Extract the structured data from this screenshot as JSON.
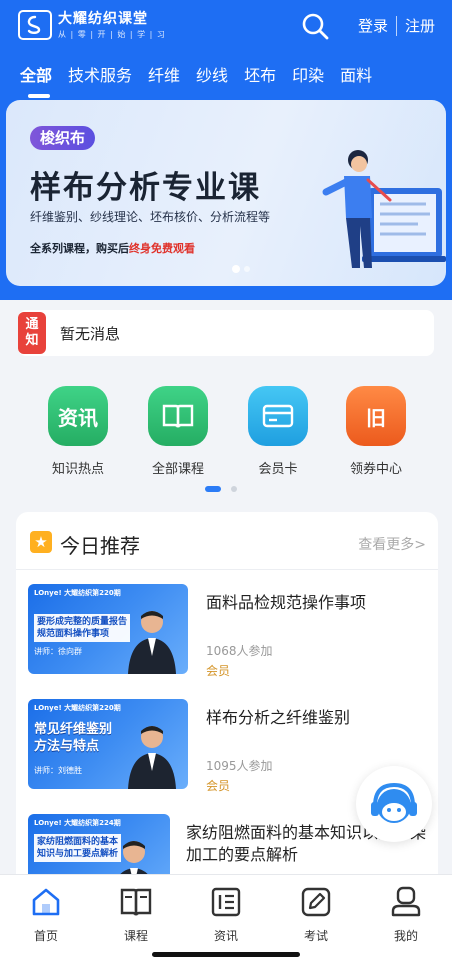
{
  "brand": {
    "title": "大耀纺织课堂",
    "subtitle": "从 | 零 | 开 | 始 | 学 | 习"
  },
  "header": {
    "login": "登录",
    "register": "注册"
  },
  "tabs": [
    {
      "label": "全部",
      "active": true
    },
    {
      "label": "技术服务"
    },
    {
      "label": "纤维"
    },
    {
      "label": "纱线"
    },
    {
      "label": "坯布"
    },
    {
      "label": "印染"
    },
    {
      "label": "面料"
    }
  ],
  "banner": {
    "badge": "梭织布",
    "title": "样布分析专业课",
    "desc": "纤维鉴别、纱线理论、坯布核价、分析流程等",
    "note_prefix": "全系列课程，购买后",
    "note_highlight": "终身免费观看"
  },
  "notice": {
    "tag_line1": "通",
    "tag_line2": "知",
    "text": "暂无消息"
  },
  "quick_menu": [
    {
      "icon_text": "资讯",
      "label": "知识热点",
      "icon": "news-icon",
      "color": "#2fbf71"
    },
    {
      "icon_text": "",
      "label": "全部课程",
      "icon": "book-icon",
      "color": "#2ec36f"
    },
    {
      "icon_text": "",
      "label": "会员卡",
      "icon": "card-icon",
      "color": "#2ab4ea"
    },
    {
      "icon_text": "旧",
      "label": "领券中心",
      "icon": "coupon-icon",
      "color": "#f26b2a"
    }
  ],
  "recommend": {
    "title": "今日推荐",
    "more": "查看更多>",
    "courses": [
      {
        "title": "面料品检规范操作事项",
        "count": "1068人参加",
        "tag": "会员",
        "thumb_top": "LOnye! 大耀纺织第220期",
        "thumb_cap": "要形成完整的质量报告\n规范面料操作事项",
        "thumb_teacher": "讲师：徐向群"
      },
      {
        "title": "样布分析之纤维鉴别",
        "count": "1095人参加",
        "tag": "会员",
        "thumb_top": "LOnye! 大耀纺织第220期",
        "thumb_cap": "常见纤维鉴别\n方法与特点",
        "thumb_teacher": "讲师：刘德胜"
      },
      {
        "title": "家纺阻燃面料的基本知识以及印染加工的要点解析",
        "count": "",
        "tag": "",
        "thumb_top": "LOnye! 大耀纺织第224期",
        "thumb_cap": "家纺阻燃面料的基本\n知识与加工要点解析",
        "thumb_teacher": ""
      }
    ]
  },
  "tabbar": [
    {
      "label": "首页",
      "icon": "home-icon",
      "active": true
    },
    {
      "label": "课程",
      "icon": "course-book-icon"
    },
    {
      "label": "资讯",
      "icon": "info-icon"
    },
    {
      "label": "考试",
      "icon": "exam-icon"
    },
    {
      "label": "我的",
      "icon": "profile-icon"
    }
  ],
  "colors": {
    "primary": "#1e6ef3",
    "accent_red": "#e0322b",
    "member_gold": "#d4952a"
  }
}
